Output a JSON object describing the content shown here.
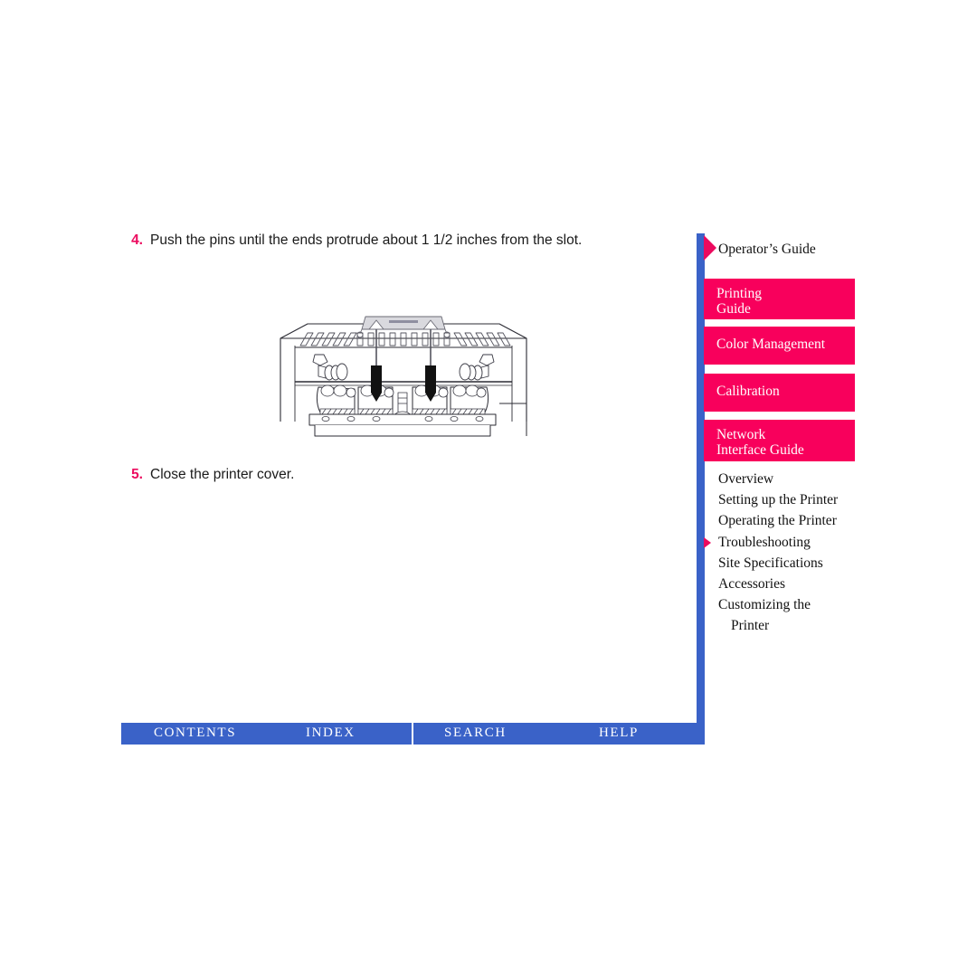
{
  "document": {
    "steps": [
      {
        "number": "4.",
        "text": "Push the pins until the ends protrude about 1 1/2 inches from the slot."
      },
      {
        "number": "5.",
        "text": "Close the printer cover."
      }
    ],
    "figure": {
      "caption": "printer-interior-pins-illustration"
    }
  },
  "sidebar": {
    "title": "Operator’s Guide",
    "guides": [
      {
        "line1": "Printing",
        "line2": "Guide"
      },
      {
        "line1": "Color Management",
        "line2": ""
      },
      {
        "line1": "Calibration",
        "line2": ""
      },
      {
        "line1": "Network",
        "line2": "Interface Guide"
      }
    ],
    "items": [
      {
        "label": "Overview",
        "sub": "",
        "selected": false
      },
      {
        "label": "Setting up the Printer",
        "sub": "",
        "selected": false
      },
      {
        "label": "Operating the Printer",
        "sub": "",
        "selected": false
      },
      {
        "label": "Troubleshooting",
        "sub": "",
        "selected": true
      },
      {
        "label": "Site Specifications",
        "sub": "",
        "selected": false
      },
      {
        "label": "Accessories",
        "sub": "",
        "selected": false
      },
      {
        "label": "Customizing the",
        "sub": "Printer",
        "selected": false
      }
    ]
  },
  "bottombar": {
    "items": [
      "CONTENTS",
      "INDEX",
      "SEARCH",
      "HELP"
    ]
  },
  "colors": {
    "magenta": "#f8005c",
    "accent_pink": "#ec0a5e",
    "blue": "#3a62c8",
    "text": "#111111"
  }
}
